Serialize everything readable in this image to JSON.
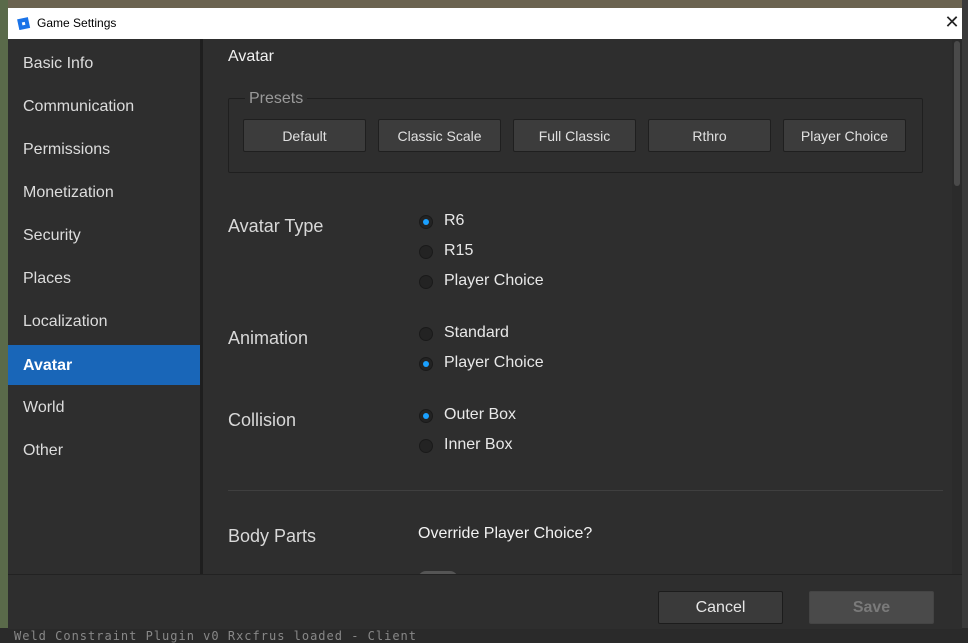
{
  "window": {
    "title": "Game Settings"
  },
  "sidebar": {
    "items": [
      {
        "label": "Basic Info"
      },
      {
        "label": "Communication"
      },
      {
        "label": "Permissions"
      },
      {
        "label": "Monetization"
      },
      {
        "label": "Security"
      },
      {
        "label": "Places"
      },
      {
        "label": "Localization"
      },
      {
        "label": "Avatar",
        "active": true
      },
      {
        "label": "World"
      },
      {
        "label": "Other"
      }
    ]
  },
  "main": {
    "section_title": "Avatar",
    "presets": {
      "legend": "Presets",
      "buttons": [
        "Default",
        "Classic Scale",
        "Full Classic",
        "Rthro",
        "Player Choice"
      ]
    },
    "avatar_type": {
      "label": "Avatar Type",
      "options": [
        "R6",
        "R15",
        "Player Choice"
      ],
      "selected": "R6"
    },
    "animation": {
      "label": "Animation",
      "options": [
        "Standard",
        "Player Choice"
      ],
      "selected": "Player Choice"
    },
    "collision": {
      "label": "Collision",
      "options": [
        "Outer Box",
        "Inner Box"
      ],
      "selected": "Outer Box"
    },
    "body_parts": {
      "label": "Body Parts",
      "override_label": "Override Player Choice?"
    }
  },
  "footer": {
    "cancel_label": "Cancel",
    "save_label": "Save"
  },
  "colors": {
    "accent": "#1966b8",
    "radio_selected": "#1aa0ff",
    "background": "#2e2e2e"
  },
  "background_console": {
    "text": "Weld Constraint Plugin v0 Rxcfrus loaded - Client"
  }
}
